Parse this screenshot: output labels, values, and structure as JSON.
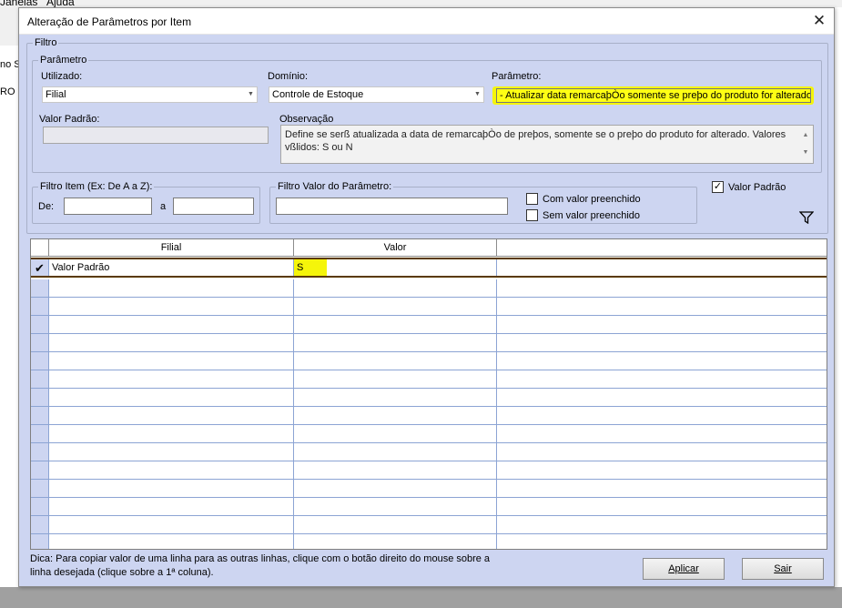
{
  "background_app": {
    "menu_items": [
      "Janelas",
      "Ajuda"
    ],
    "side_texts": [
      "no Si",
      "RO"
    ]
  },
  "dialog": {
    "title": "Alteração de Parâmetros por Item",
    "close_glyph": "✕"
  },
  "filtro": {
    "legend": "Filtro",
    "parametro": {
      "legend": "Parâmetro",
      "utilizado_label": "Utilizado:",
      "utilizado_value": "Filial",
      "dominio_label": "Domínio:",
      "dominio_value": "Controle de Estoque",
      "parametro_label": "Parâmetro:",
      "parametro_value": "- Atualizar data remarcaþÒo somente se preþo do produto for alterado",
      "valor_padrao_label": "Valor Padrão:",
      "valor_padrao_value": "",
      "observacao_label": "Observação",
      "observacao_text": "Define se serß atualizada a data de remarcaþÒo de preþos, somente se o preþo do produto for alterado. Valores vßlidos: S ou N"
    },
    "filtro_item": {
      "legend": "Filtro Item (Ex: De A a Z):",
      "de_label": "De:",
      "de_value": "",
      "a_label": "a",
      "a_value": ""
    },
    "filtro_valor": {
      "legend": "Filtro Valor do Parâmetro:",
      "value": "",
      "com_valor_label": "Com valor preenchido",
      "com_valor_checked": false,
      "sem_valor_label": "Sem valor preenchido",
      "sem_valor_checked": false
    },
    "valor_padrao_check_label": "Valor Padrão",
    "valor_padrao_check_checked": true
  },
  "grid": {
    "columns": [
      "Filial",
      "Valor"
    ],
    "rows": [
      {
        "filial": "Valor Padrão",
        "valor": "S",
        "checked": "✔"
      }
    ],
    "empty_rows": 15
  },
  "footer": {
    "hint": "Dica: Para copiar valor de uma linha para as outras linhas, clique com o botão direito do mouse sobre a linha desejada (clique sobre a 1ª coluna).",
    "apply_label": "Aplicar",
    "exit_label": "Sair"
  },
  "colors": {
    "dialog_bg": "#cdd5f1",
    "highlight": "#f5f50a",
    "grid_line": "#8ca4d4"
  }
}
